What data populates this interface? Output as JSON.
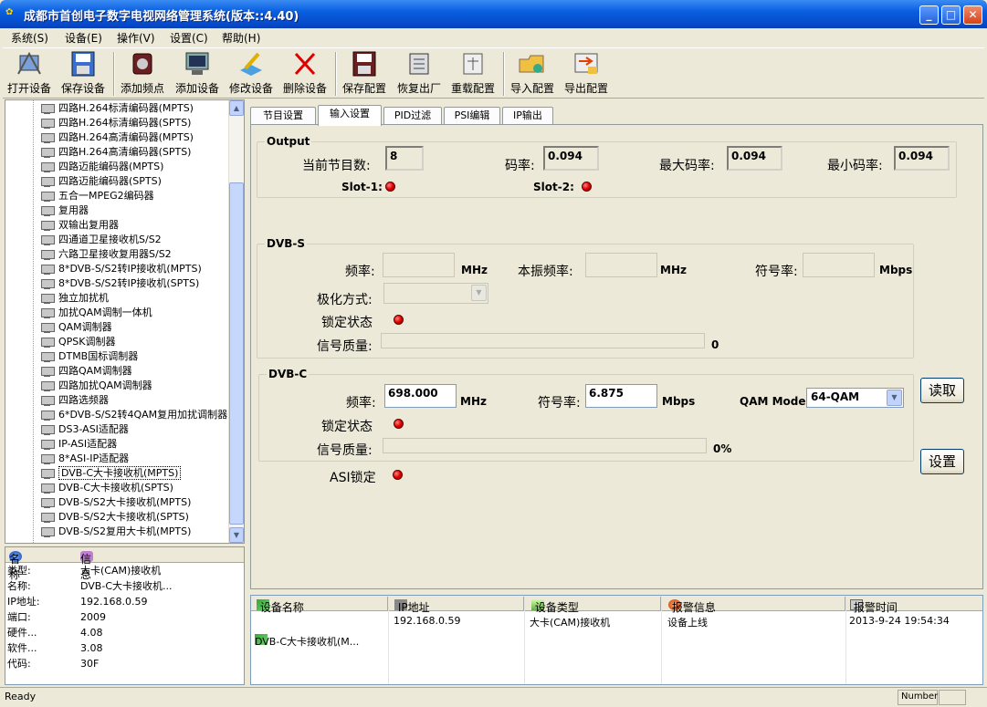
{
  "window": {
    "title": "成都市首创电子数字电视网络管理系统(版本::4.40)"
  },
  "menu": [
    "系统(S)",
    "设备(E)",
    "操作(V)",
    "设置(C)",
    "帮助(H)"
  ],
  "toolbar": [
    {
      "label": "打开设备",
      "icon": "open-device-icon"
    },
    {
      "label": "保存设备",
      "icon": "save-device-icon"
    },
    {
      "label": "添加频点",
      "icon": "add-frequency-icon"
    },
    {
      "label": "添加设备",
      "icon": "add-device-icon"
    },
    {
      "label": "修改设备",
      "icon": "edit-device-icon"
    },
    {
      "label": "删除设备",
      "icon": "delete-device-icon"
    },
    {
      "label": "保存配置",
      "icon": "save-config-icon"
    },
    {
      "label": "恢复出厂",
      "icon": "factory-reset-icon"
    },
    {
      "label": "重载配置",
      "icon": "reload-config-icon"
    },
    {
      "label": "导入配置",
      "icon": "import-config-icon"
    },
    {
      "label": "导出配置",
      "icon": "export-config-icon"
    }
  ],
  "tree": [
    "四路H.264标清编码器(MPTS)",
    "四路H.264标清编码器(SPTS)",
    "四路H.264高清编码器(MPTS)",
    "四路H.264高清编码器(SPTS)",
    "四路迈能编码器(MPTS)",
    "四路迈能编码器(SPTS)",
    "五合一MPEG2编码器",
    "复用器",
    "双输出复用器",
    "四通道卫星接收机S/S2",
    "六路卫星接收复用器S/S2",
    "8*DVB-S/S2转IP接收机(MPTS)",
    "8*DVB-S/S2转IP接收机(SPTS)",
    "独立加扰机",
    "加扰QAM调制一体机",
    "QAM调制器",
    "QPSK调制器",
    "DTMB国标调制器",
    "四路QAM调制器",
    "四路加扰QAM调制器",
    "四路选频器",
    "6*DVB-S/S2转4QAM复用加扰调制器",
    "DS3-ASI适配器",
    "IP-ASI适配器",
    "8*ASI-IP适配器",
    "DVB-C大卡接收机(MPTS)",
    "DVB-C大卡接收机(SPTS)",
    "DVB-S/S2大卡接收机(MPTS)",
    "DVB-S/S2大卡接收机(SPTS)",
    "DVB-S/S2复用大卡机(MPTS)"
  ],
  "info": {
    "headers": {
      "name": "名称",
      "info": "信息"
    },
    "rows": [
      {
        "key": "类型:",
        "value": "大卡(CAM)接收机"
      },
      {
        "key": "名称:",
        "value": "DVB-C大卡接收机..."
      },
      {
        "key": "IP地址:",
        "value": "192.168.0.59"
      },
      {
        "key": "端口:",
        "value": "2009"
      },
      {
        "key": "硬件...",
        "value": "4.08"
      },
      {
        "key": "软件...",
        "value": "3.08"
      },
      {
        "key": "代码:",
        "value": "30F"
      }
    ]
  },
  "tabs": [
    "节目设置",
    "输入设置",
    "PID过滤",
    "PSI编辑",
    "IP输出"
  ],
  "output": {
    "title": "Output",
    "program_count_label": "当前节目数:",
    "program_count": "8",
    "bitrate_label": "码率:",
    "bitrate": "0.094",
    "max_label": "最大码率:",
    "max": "0.094",
    "min_label": "最小码率:",
    "min": "0.094",
    "slot1": "Slot-1:",
    "slot2": "Slot-2:"
  },
  "dvbs": {
    "title": "DVB-S",
    "freq_label": "频率:",
    "freq_unit": "MHz",
    "lo_label": "本振频率:",
    "lo_unit": "MHz",
    "sym_label": "符号率:",
    "sym_unit": "Mbps",
    "pol_label": "极化方式:",
    "lock_label": "锁定状态",
    "quality_label": "信号质量:",
    "quality": "0"
  },
  "dvbc": {
    "title": "DVB-C",
    "freq_label": "频率:",
    "freq": "698.000",
    "freq_unit": "MHz",
    "sym_label": "符号率:",
    "sym": "6.875",
    "sym_unit": "Mbps",
    "qam_label": "QAM Mode:",
    "qam": "64-QAM",
    "lock_label": "锁定状态",
    "quality_label": "信号质量:",
    "quality": "0%"
  },
  "asi_lock_label": "ASI锁定",
  "buttons": {
    "read": "读取",
    "set": "设置"
  },
  "alarm": {
    "headers": [
      "设备名称",
      "IP地址",
      "设备类型",
      "报警信息",
      "报警时间"
    ],
    "row": [
      "DVB-C大卡接收机(M...",
      "192.168.0.59",
      "大卡(CAM)接收机",
      "设备上线",
      "2013-9-24 19:54:34"
    ]
  },
  "status": {
    "text": "Ready",
    "number": "Number"
  }
}
